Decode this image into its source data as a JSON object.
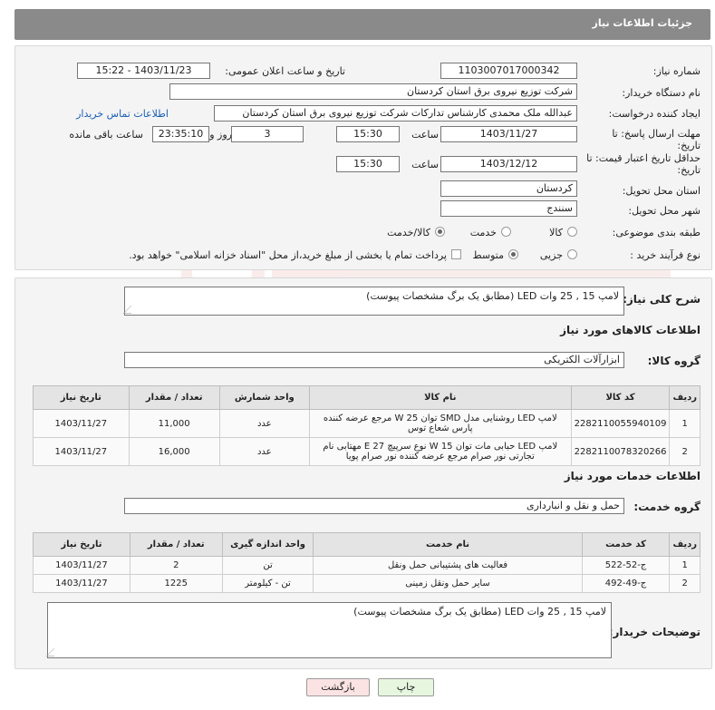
{
  "header": {
    "title": "جزئیات اطلاعات نیاز"
  },
  "info": {
    "need_number_label": "شماره نیاز:",
    "need_number": "1103007017000342",
    "announce_label": "تاریخ و ساعت اعلان عمومی:",
    "announce_value": "1403/11/23 - 15:22",
    "buyer_org_label": "نام دستگاه خریدار:",
    "buyer_org": "شرکت توزیع نیروی برق استان کردستان",
    "creator_label": "ایجاد کننده درخواست:",
    "creator": "عبدالله ملک محمدی کارشناس تدارکات شرکت توزیع نیروی برق استان کردستان",
    "contact_link": "اطلاعات تماس خریدار",
    "deadline_label": "مهلت ارسال پاسخ: تا",
    "deadline_label2": "تاریخ:",
    "deadline_date": "1403/11/27",
    "hour_label": "ساعت",
    "deadline_time": "15:30",
    "days_value": "3",
    "days_label": "روز و",
    "remaining_time": "23:35:10",
    "remaining_label": "ساعت باقی مانده",
    "validity_label": "حداقل تاریخ اعتبار قیمت: تا",
    "validity_label2": "تاریخ:",
    "validity_date": "1403/12/12",
    "validity_time": "15:30",
    "province_label": "استان محل تحویل:",
    "province": "کردستان",
    "city_label": "شهر محل تحویل:",
    "city": "سنندج",
    "category_label": "طبقه بندی موضوعی:",
    "category_options": [
      "کالا",
      "خدمت",
      "کالا/خدمت"
    ],
    "category_selected": "کالا/خدمت",
    "process_label": "نوع فرآیند خرید :",
    "process_options": [
      "جزیی",
      "متوسط"
    ],
    "process_selected": "متوسط",
    "payment_note": "پرداخت تمام یا بخشی از مبلغ خرید،از محل \"اسناد خزانه اسلامی\" خواهد بود."
  },
  "summary": {
    "label": "شرح کلی نیاز:",
    "text": "لامپ 15 , 25 وات LED  (مطابق  یک  برگ  مشخصات پیوست)"
  },
  "goods": {
    "section_title": "اطلاعات کالاهای مورد نیاز",
    "group_label": "گروه کالا:",
    "group_value": "ابزارآلات الکتریکی",
    "columns": [
      "ردیف",
      "کد کالا",
      "نام کالا",
      "واحد شمارش",
      "تعداد / مقدار",
      "تاریخ نیاز"
    ],
    "rows": [
      {
        "idx": "1",
        "code": "2282110055940109",
        "name": "لامپ LED روشنایی مدل SMD توان W 25 مرجع عرضه کننده پارس شعاع توس",
        "unit": "عدد",
        "qty": "11,000",
        "date": "1403/11/27"
      },
      {
        "idx": "2",
        "code": "2282110078320266",
        "name": "لامپ LED حبابی مات توان W 15 نوع سرپیچ E 27 مهتابی نام تجارتی نور صرام مرجع عرضه کننده نور صرام پویا",
        "unit": "عدد",
        "qty": "16,000",
        "date": "1403/11/27"
      }
    ]
  },
  "services": {
    "section_title": "اطلاعات خدمات مورد نیاز",
    "group_label": "گروه خدمت:",
    "group_value": "حمل و نقل و انبارداری",
    "columns": [
      "ردیف",
      "کد خدمت",
      "نام خدمت",
      "واحد اندازه گیری",
      "تعداد / مقدار",
      "تاریخ نیاز"
    ],
    "rows": [
      {
        "idx": "1",
        "code": "ج-52-522",
        "name": "فعالیت های پشتیبانی حمل ونقل",
        "unit": "تن",
        "qty": "2",
        "date": "1403/11/27"
      },
      {
        "idx": "2",
        "code": "ج-49-492",
        "name": "سایر حمل ونقل زمینی",
        "unit": "تن - کیلومتر",
        "qty": "1225",
        "date": "1403/11/27"
      }
    ]
  },
  "buyer_notes": {
    "label": "توضیحات خریدار:",
    "text": "لامپ 15 , 25 وات LED  (مطابق  یک  برگ  مشخصات پیوست)"
  },
  "buttons": {
    "print": "چاپ",
    "back": "بازگشت"
  },
  "colors": {
    "header": "#8a8a8a",
    "link": "#1a5fb4",
    "print_btn": "#e7f7df",
    "back_btn": "#fbe3e3"
  }
}
